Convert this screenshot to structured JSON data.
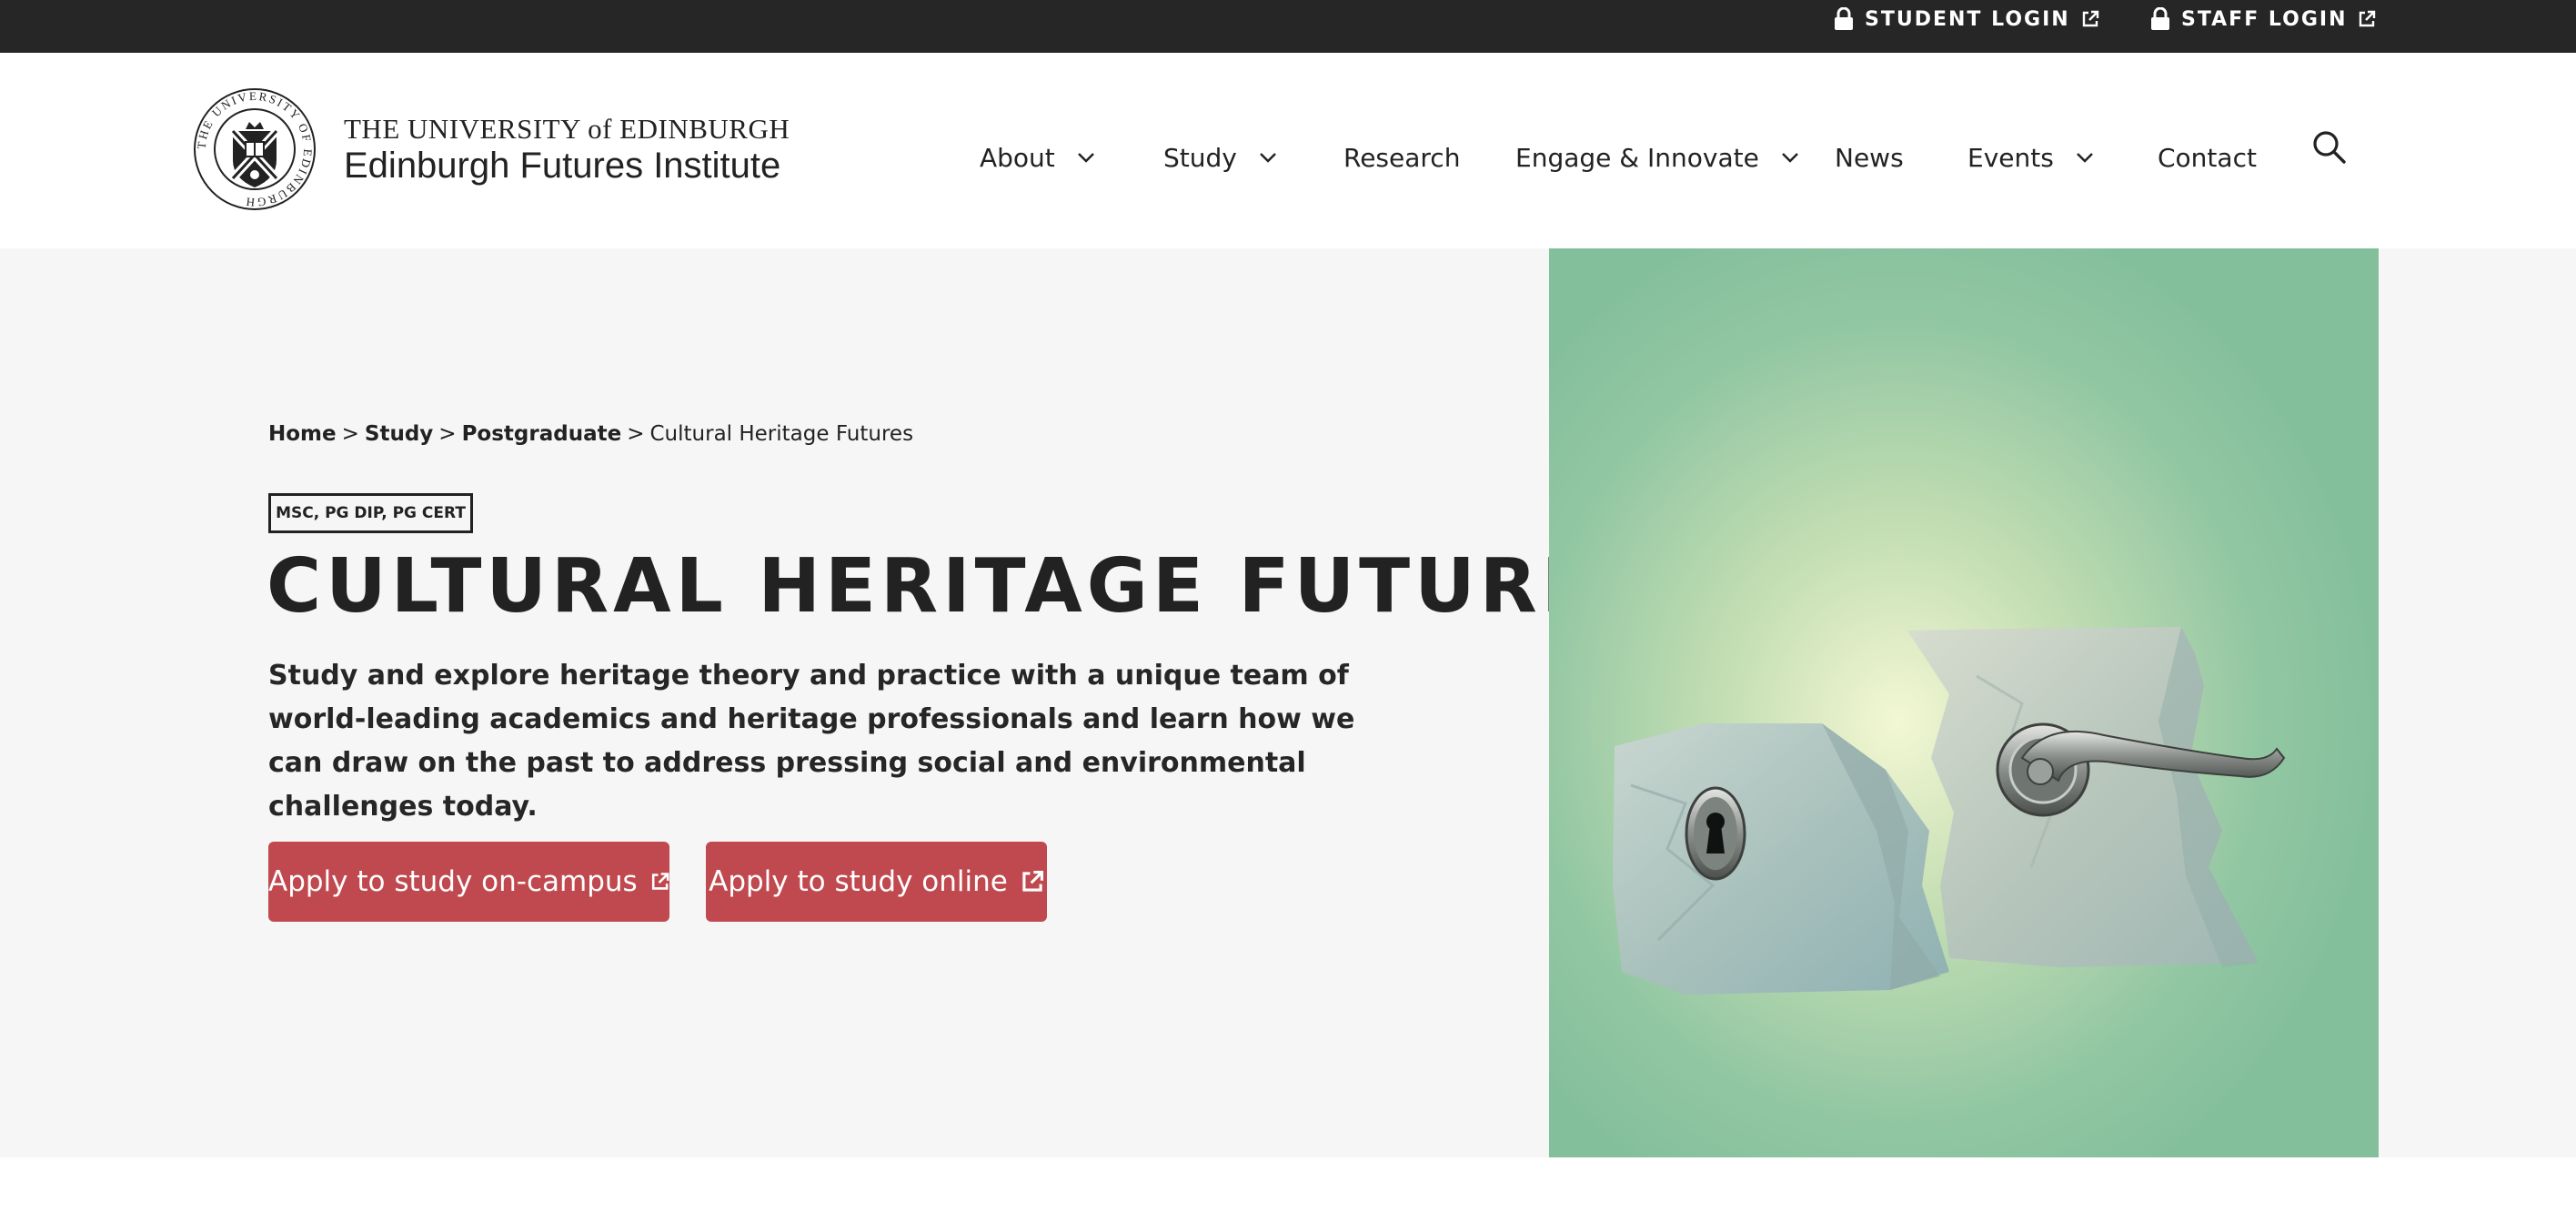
{
  "utility_bar": {
    "student_login": "STUDENT LOGIN",
    "staff_login": "STAFF LOGIN"
  },
  "header": {
    "logo_line1": "THE UNIVERSITY of EDINBURGH",
    "logo_line2": "Edinburgh Futures Institute",
    "crest_text": "THE UNIVERSITY OF EDINBURGH"
  },
  "nav": {
    "items": [
      {
        "label": "About",
        "dropdown": true
      },
      {
        "label": "Study",
        "dropdown": true
      },
      {
        "label": "Research",
        "dropdown": false
      },
      {
        "label": "Engage & Innovate",
        "dropdown": true
      },
      {
        "label": "News",
        "dropdown": false
      },
      {
        "label": "Events",
        "dropdown": true
      },
      {
        "label": "Contact",
        "dropdown": false
      }
    ],
    "search_icon": "search-icon"
  },
  "breadcrumb": {
    "items": [
      "Home",
      "Study",
      "Postgraduate"
    ],
    "current": "Cultural Heritage Futures",
    "separator": ">"
  },
  "hero": {
    "badge": "MSC, PG DIP, PG CERT",
    "title": "CULTURAL HERITAGE FUTURES",
    "description": "Study and explore heritage theory and practice with a unique team of world-leading academics and heritage professionals and learn how we can draw on the past to address pressing social and environmental challenges today.",
    "buttons": [
      {
        "label": "Apply to study on-campus",
        "icon": "external-link-icon"
      },
      {
        "label": "Apply to study online",
        "icon": "external-link-icon"
      }
    ],
    "image_icon": "stone-door-illustration"
  },
  "colors": {
    "topbar": "#262626",
    "hero_background": "#f6f6f6",
    "button": "#c0494f",
    "image_background": "#84bf9c",
    "text": "#222222"
  }
}
